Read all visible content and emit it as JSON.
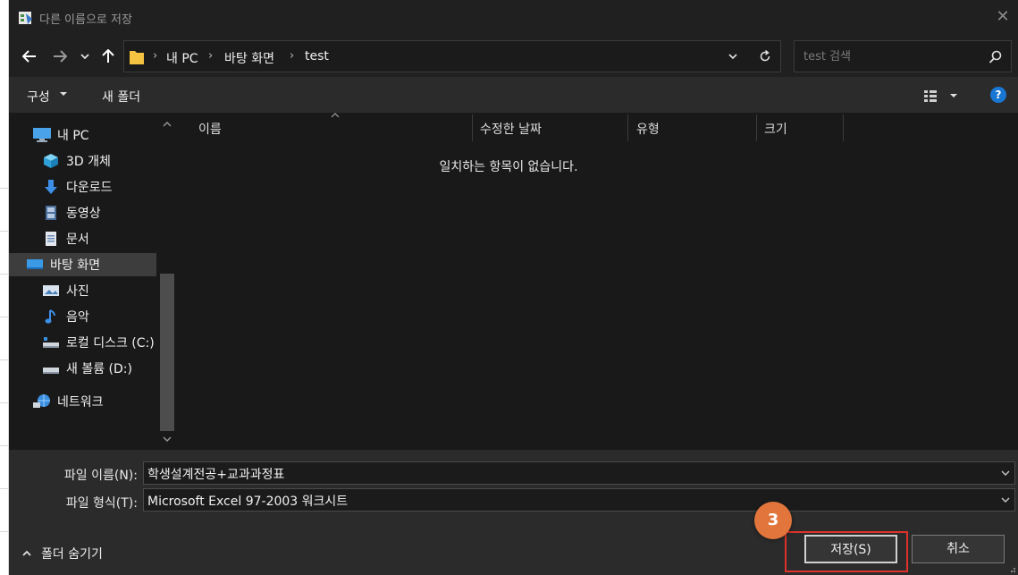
{
  "window": {
    "title": "다른 이름으로 저장"
  },
  "navigation": {
    "breadcrumbs": [
      "내 PC",
      "바탕 화면",
      "test"
    ],
    "search_placeholder": "test 검색"
  },
  "toolbar": {
    "organize_label": "구성",
    "new_folder_label": "새 폴더"
  },
  "sidebar": {
    "items": [
      {
        "label": "내 PC",
        "icon": "pc-icon"
      },
      {
        "label": "3D 개체",
        "icon": "3d-objects-icon"
      },
      {
        "label": "다운로드",
        "icon": "download-icon"
      },
      {
        "label": "동영상",
        "icon": "video-icon"
      },
      {
        "label": "문서",
        "icon": "document-icon"
      },
      {
        "label": "바탕 화면",
        "icon": "desktop-icon",
        "selected": true
      },
      {
        "label": "사진",
        "icon": "pictures-icon"
      },
      {
        "label": "음악",
        "icon": "music-icon"
      },
      {
        "label": "로컬 디스크 (C:)",
        "icon": "local-disk-icon"
      },
      {
        "label": "새 볼륨 (D:)",
        "icon": "drive-icon"
      },
      {
        "label": "네트워크",
        "icon": "network-icon"
      }
    ]
  },
  "file_list": {
    "columns": [
      "이름",
      "수정한 날짜",
      "유형",
      "크기"
    ],
    "empty_message": "일치하는 항목이 없습니다."
  },
  "form": {
    "filename_label": "파일 이름(N):",
    "filename_value": "학생설계전공+교과과정표",
    "filetype_label": "파일 형식(T):",
    "filetype_value": "Microsoft Excel 97-2003 워크시트"
  },
  "footer": {
    "hide_folders_label": "폴더 숨기기",
    "save_label": "저장(S)",
    "cancel_label": "취소",
    "step_number": "3"
  },
  "colors": {
    "accent": "#1976d2",
    "highlight": "#e0312b",
    "badge": "#e1753c",
    "background": "#202020"
  }
}
